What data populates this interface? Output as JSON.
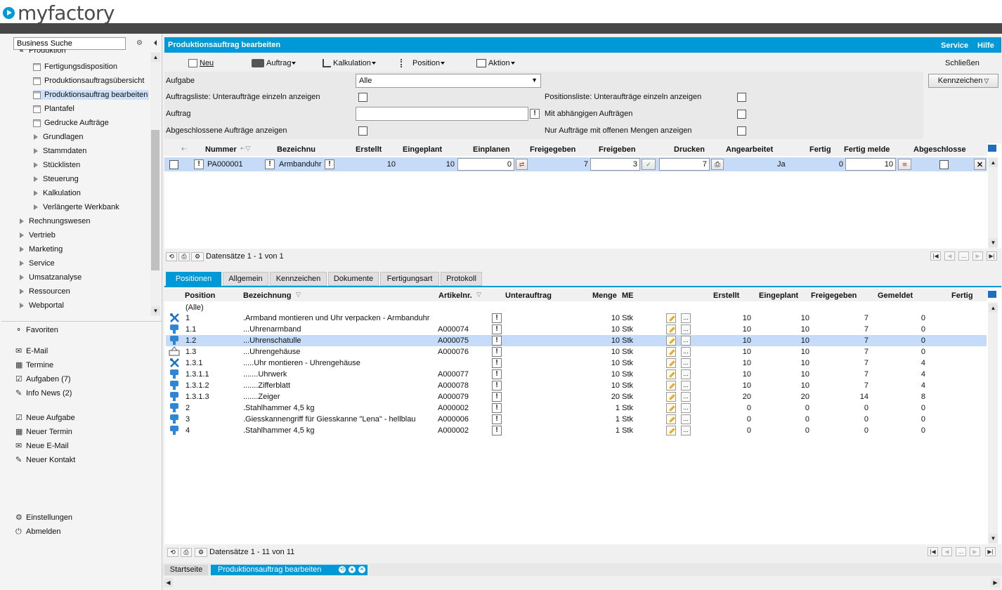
{
  "app": {
    "logo_text": "myfactory"
  },
  "sidebar": {
    "search_value": "Business Suche",
    "partial_top": "Produktion",
    "prod_items": [
      {
        "label": "Fertigungsdisposition"
      },
      {
        "label": "Produktionsauftragsübersicht"
      },
      {
        "label": "Produktionsauftrag bearbeiten"
      },
      {
        "label": "Plantafel"
      },
      {
        "label": "Gedrucke Aufträge"
      }
    ],
    "prod_groups": [
      {
        "label": "Grundlagen"
      },
      {
        "label": "Stammdaten"
      },
      {
        "label": "Stücklisten"
      },
      {
        "label": "Steuerung"
      },
      {
        "label": "Kalkulation"
      },
      {
        "label": "Verlängerte Werkbank"
      }
    ],
    "top_groups": [
      {
        "label": "Rechnungswesen"
      },
      {
        "label": "Vertrieb"
      },
      {
        "label": "Marketing"
      },
      {
        "label": "Service"
      },
      {
        "label": "Umsatzanalyse"
      },
      {
        "label": "Ressourcen"
      },
      {
        "label": "Webportal"
      }
    ],
    "favorites": "Favoriten",
    "links1": [
      {
        "label": "E-Mail"
      },
      {
        "label": "Termine"
      },
      {
        "label": "Aufgaben (7)"
      },
      {
        "label": "Info News (2)"
      }
    ],
    "links2": [
      {
        "label": "Neue Aufgabe"
      },
      {
        "label": "Neuer Termin"
      },
      {
        "label": "Neue E-Mail"
      },
      {
        "label": "Neuer Kontakt"
      }
    ],
    "settings": "Einstellungen",
    "logout": "Abmelden"
  },
  "header": {
    "title": "Produktionsauftrag bearbeiten",
    "service": "Service",
    "help": "Hilfe"
  },
  "toolbar": {
    "neu": "Neu",
    "auftrag": "Auftrag",
    "kalkulation": "Kalkulation",
    "position": "Position",
    "aktion": "Aktion",
    "schliessen": "Schließen"
  },
  "filters": {
    "aufgabe_label": "Aufgabe",
    "aufgabe_value": "Alle",
    "auftragsliste_label": "Auftragsliste: Unteraufträge einzeln anzeigen",
    "auftrag_label": "Auftrag",
    "abgeschlossen_label": "Abgeschlossene Aufträge anzeigen",
    "positionsliste_label": "Positionsliste: Unteraufträge einzeln anzeigen",
    "abhaengig_label": "Mit abhängigen Aufträgen",
    "offen_label": "Nur Aufträge mit offenen Mengen anzeigen",
    "kennzeichen_button": "Kennzeichen"
  },
  "orders": {
    "headers": {
      "nummer": "Nummer",
      "bezeichnung": "Bezeichnu",
      "erstellt": "Erstellt",
      "eingeplant": "Eingeplant",
      "einplanen": "Einplanen",
      "freigegeben": "Freigegeben",
      "freigeben": "Freigeben",
      "drucken": "Drucken",
      "angearbeitet": "Angearbeitet",
      "fertig": "Fertig",
      "fertig_melden": "Fertig melde",
      "abgeschlossen": "Abgeschlosse"
    },
    "row": {
      "nummer": "PA000001",
      "bezeichnung": "Armbanduhr",
      "erstellt": "10",
      "eingeplant": "10",
      "einplanen": "0",
      "freigegeben": "7",
      "freigeben": "3",
      "drucken": "7",
      "angearbeitet": "Ja",
      "fertig": "0",
      "fertig_melden": "10"
    },
    "pager": "Datensätze 1 - 1 von 1"
  },
  "tabs": [
    {
      "label": "Positionen"
    },
    {
      "label": "Allgemein"
    },
    {
      "label": "Kennzeichen"
    },
    {
      "label": "Dokumente"
    },
    {
      "label": "Fertigungsart"
    },
    {
      "label": "Protokoll"
    }
  ],
  "positions": {
    "headers": {
      "position": "Position",
      "bezeichnung": "Bezeichnung",
      "artikelnr": "Artikelnr.",
      "unterauftrag": "Unterauftrag",
      "menge": "Menge",
      "me": "ME",
      "erstellt": "Erstellt",
      "eingeplant": "Eingeplant",
      "freigegeben": "Freigegeben",
      "gemeldet": "Gemeldet",
      "fertig": "Fertig"
    },
    "all_label": "(Alle)",
    "rows": [
      {
        "pos": "1",
        "bez": ".Armband montieren und Uhr verpacken - Armbanduhr",
        "art": "",
        "menge": "10 Stk",
        "erstellt": "10",
        "eingeplant": "10",
        "freigegeben": "7",
        "gemeldet": "0",
        "icon": "work-icon"
      },
      {
        "pos": "1.1",
        "bez": "...Uhrenarmband",
        "art": "A000074",
        "menge": "10 Stk",
        "erstellt": "10",
        "eingeplant": "10",
        "freigegeben": "7",
        "gemeldet": "0",
        "icon": "part-icon"
      },
      {
        "pos": "1.2",
        "bez": "...Uhrenschatulle",
        "art": "A000075",
        "menge": "10 Stk",
        "erstellt": "10",
        "eingeplant": "10",
        "freigegeben": "7",
        "gemeldet": "0",
        "icon": "part-icon"
      },
      {
        "pos": "1.3",
        "bez": "...Uhrengehäuse",
        "art": "A000076",
        "menge": "10 Stk",
        "erstellt": "10",
        "eingeplant": "10",
        "freigegeben": "7",
        "gemeldet": "0",
        "icon": "assembly-icon"
      },
      {
        "pos": "1.3.1",
        "bez": ".....Uhr montieren - Uhrengehäuse",
        "art": "",
        "menge": "10 Stk",
        "erstellt": "10",
        "eingeplant": "10",
        "freigegeben": "7",
        "gemeldet": "4",
        "icon": "work-icon"
      },
      {
        "pos": "1.3.1.1",
        "bez": ".......Uhrwerk",
        "art": "A000077",
        "menge": "10 Stk",
        "erstellt": "10",
        "eingeplant": "10",
        "freigegeben": "7",
        "gemeldet": "4",
        "icon": "part-icon"
      },
      {
        "pos": "1.3.1.2",
        "bez": ".......Zifferblatt",
        "art": "A000078",
        "menge": "10 Stk",
        "erstellt": "10",
        "eingeplant": "10",
        "freigegeben": "7",
        "gemeldet": "4",
        "icon": "part-icon"
      },
      {
        "pos": "1.3.1.3",
        "bez": ".......Zeiger",
        "art": "A000079",
        "menge": "20 Stk",
        "erstellt": "20",
        "eingeplant": "20",
        "freigegeben": "14",
        "gemeldet": "8",
        "icon": "part-icon"
      },
      {
        "pos": "2",
        "bez": ".Stahlhammer 4,5 kg",
        "art": "A000002",
        "menge": "1 Stk",
        "erstellt": "0",
        "eingeplant": "0",
        "freigegeben": "0",
        "gemeldet": "0",
        "icon": "part-icon"
      },
      {
        "pos": "3",
        "bez": ".Giesskannengriff für Giesskanne \"Lena\" - hellblau",
        "art": "A000006",
        "menge": "1 Stk",
        "erstellt": "0",
        "eingeplant": "0",
        "freigegeben": "0",
        "gemeldet": "0",
        "icon": "part-icon"
      },
      {
        "pos": "4",
        "bez": ".Stahlhammer 4,5 kg",
        "art": "A000002",
        "menge": "1 Stk",
        "erstellt": "0",
        "eingeplant": "0",
        "freigegeben": "0",
        "gemeldet": "0",
        "icon": "part-icon"
      }
    ],
    "pager": "Datensätze 1 - 11 von 11"
  },
  "bottom_tabs": [
    {
      "label": "Startseite"
    },
    {
      "label": "Produktionsauftrag bearbeiten"
    }
  ],
  "colors": {
    "accent": "#0099d8",
    "selected_row": "#c5dbf7",
    "dark_bar": "#474747"
  }
}
